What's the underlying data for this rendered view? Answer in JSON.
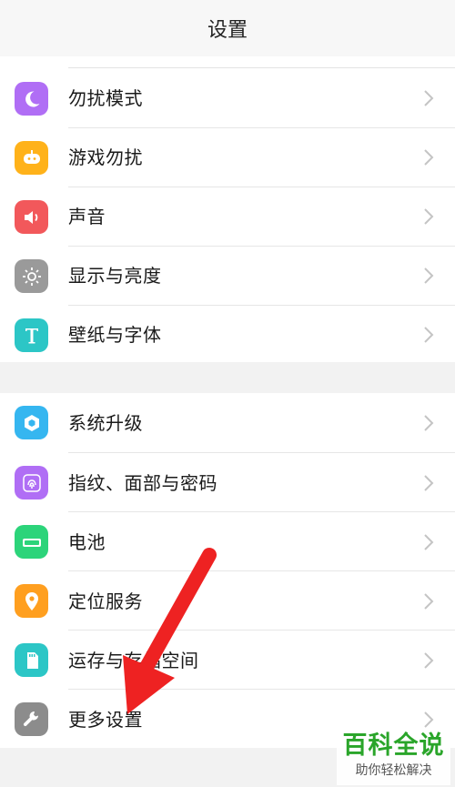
{
  "header": {
    "title": "设置"
  },
  "sections": [
    {
      "items": [
        {
          "label": "勿扰模式",
          "icon": "moon-icon",
          "color": "#b06ef5"
        },
        {
          "label": "游戏勿扰",
          "icon": "gamepad-icon",
          "color": "#ffb21a"
        },
        {
          "label": "声音",
          "icon": "speaker-icon",
          "color": "#f2585b"
        },
        {
          "label": "显示与亮度",
          "icon": "brightness-icon",
          "color": "#9a9a9a"
        },
        {
          "label": "壁纸与字体",
          "icon": "font-t-icon",
          "color": "#2cc6c6"
        }
      ]
    },
    {
      "items": [
        {
          "label": "系统升级",
          "icon": "cube-update-icon",
          "color": "#35b6f0"
        },
        {
          "label": "指纹、面部与密码",
          "icon": "fingerprint-icon",
          "color": "#b06ef5"
        },
        {
          "label": "电池",
          "icon": "battery-icon",
          "color": "#2cd47a"
        },
        {
          "label": "定位服务",
          "icon": "location-pin-icon",
          "color": "#ff9f1f"
        },
        {
          "label": "运存与存储空间",
          "icon": "sd-card-icon",
          "color": "#2cc6c6"
        },
        {
          "label": "更多设置",
          "icon": "wrench-icon",
          "color": "#8c8c8c"
        }
      ]
    }
  ],
  "annotation": {
    "arrow_color": "#ee2222"
  },
  "watermark": {
    "main": "百科全说",
    "sub": "助你轻松解决",
    "color": "#2aa52a"
  }
}
